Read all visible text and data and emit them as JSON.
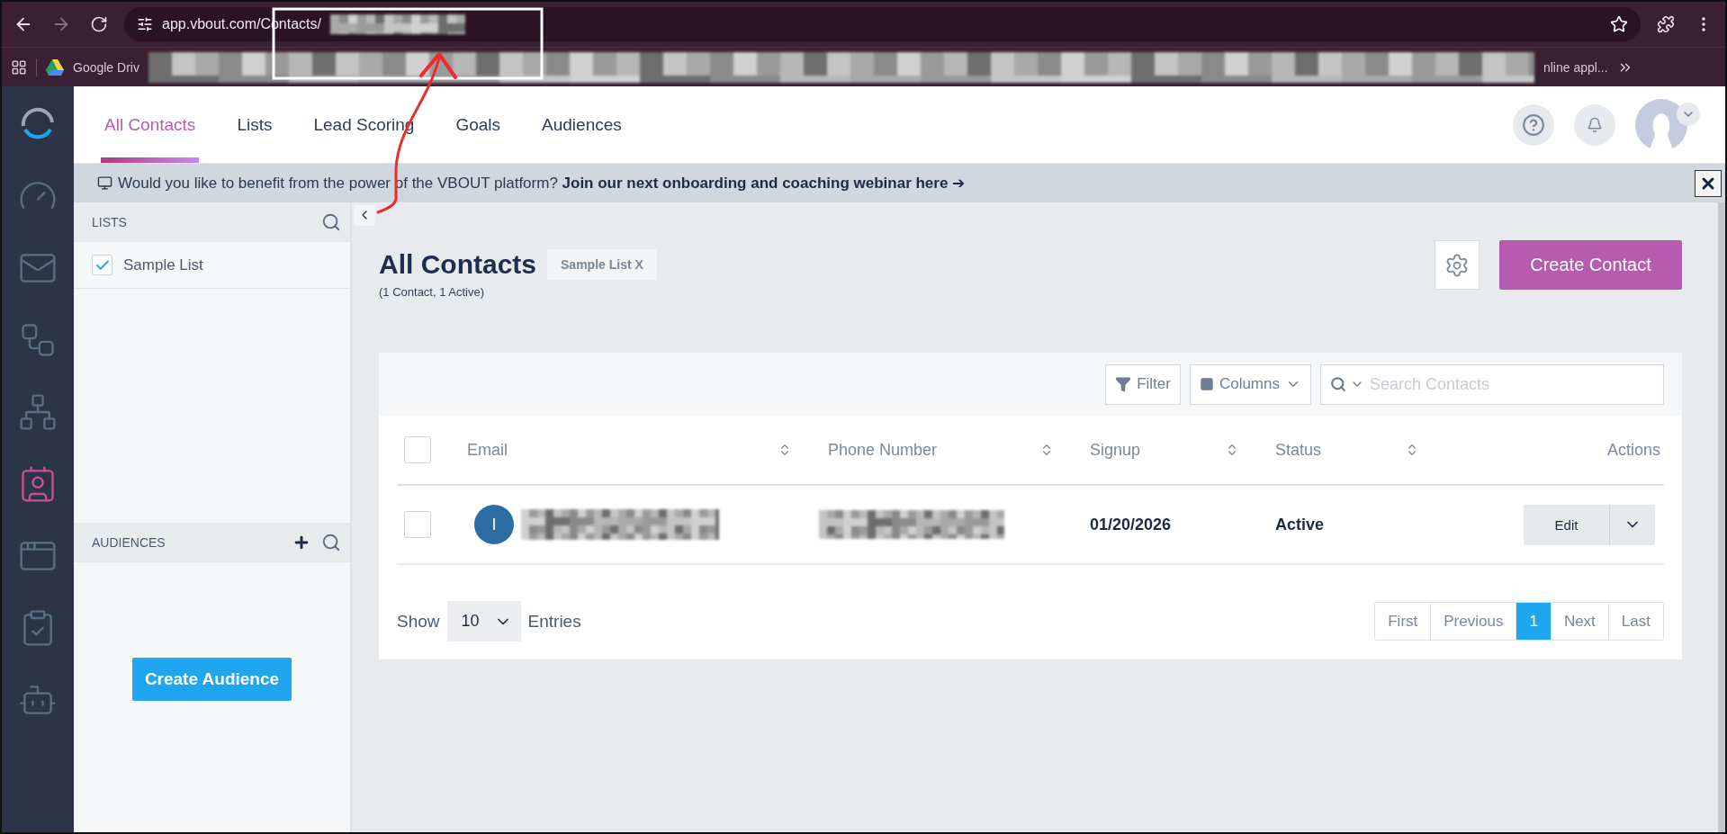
{
  "browser": {
    "url": "app.vbout.com/Contacts/",
    "forward_disabled": true,
    "bookmarks": [
      {
        "label": "Google Driv"
      },
      {
        "label": "nline appl..."
      }
    ]
  },
  "nav_tabs": [
    {
      "label": "All Contacts",
      "selected": true
    },
    {
      "label": "Lists",
      "selected": false
    },
    {
      "label": "Lead Scoring",
      "selected": false
    },
    {
      "label": "Goals",
      "selected": false
    },
    {
      "label": "Audiences",
      "selected": false
    }
  ],
  "sidebar": {
    "items": [
      {
        "kind": "dashboard",
        "selected": false
      },
      {
        "kind": "email",
        "selected": false
      },
      {
        "kind": "workflow",
        "selected": false
      },
      {
        "kind": "network",
        "selected": false
      },
      {
        "kind": "contacts",
        "selected": true
      },
      {
        "kind": "landing",
        "selected": false
      },
      {
        "kind": "forms",
        "selected": false
      },
      {
        "kind": "bot",
        "selected": false
      }
    ]
  },
  "banner": {
    "text": "Would you like to benefit from the power of the VBOUT platform? **Join our next onboarding and coaching webinar here ➔**"
  },
  "lists_panel": {
    "title": "LISTS",
    "items": [
      {
        "label": "Sample List",
        "checked": true
      }
    ]
  },
  "audiences_panel": {
    "title": "AUDIENCES",
    "button": "Create Audience"
  },
  "page": {
    "title": "All Contacts",
    "tag": "Sample List X",
    "subtitle": "(1 Contact, 1 Active)",
    "create_button": "Create Contact"
  },
  "toolbar": {
    "filter": "Filter",
    "columns": "Columns",
    "search_placeholder": "Search Contacts"
  },
  "table": {
    "all_checked": false,
    "columns": [
      {
        "label": "Email",
        "sortable": true
      },
      {
        "label": "Phone Number",
        "sortable": true
      },
      {
        "label": "Signup",
        "sortable": true
      },
      {
        "label": "Status",
        "sortable": true
      },
      {
        "label": "Actions"
      }
    ],
    "rows": [
      {
        "avatar": "I",
        "checked": false,
        "signup": "01/20/2026",
        "status": "Active",
        "action": "Edit"
      }
    ]
  },
  "footer": {
    "show": "Show",
    "entries_value": "10",
    "entries": "Entries",
    "pages": [
      {
        "label": "First",
        "selected": false
      },
      {
        "label": "Previous",
        "selected": false
      },
      {
        "label": "1",
        "selected": true
      },
      {
        "label": "Next",
        "selected": false
      },
      {
        "label": "Last",
        "selected": false
      }
    ]
  }
}
